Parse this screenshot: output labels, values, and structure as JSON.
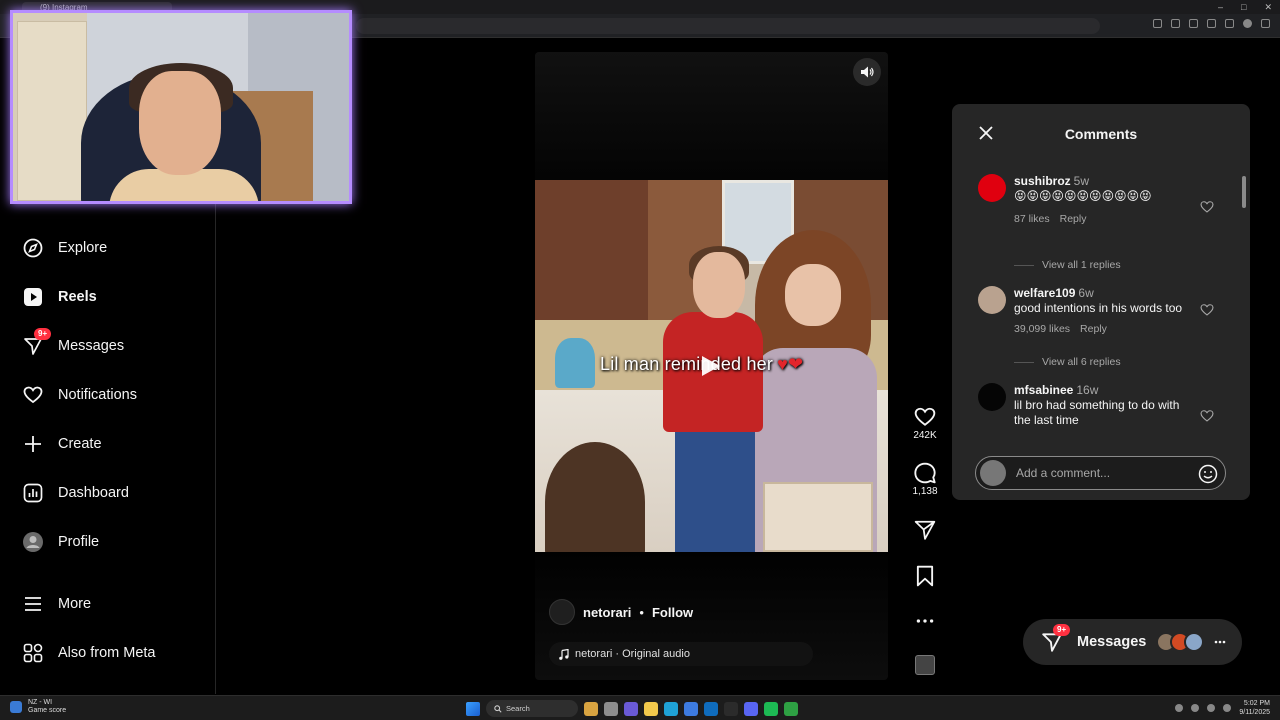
{
  "browser": {
    "tab_title": "(9) Instagram",
    "window_controls": [
      "–",
      "□",
      "✕"
    ]
  },
  "sidebar": {
    "items": [
      {
        "label": "Explore",
        "icon": "compass-icon"
      },
      {
        "label": "Reels",
        "icon": "reels-icon"
      },
      {
        "label": "Messages",
        "icon": "messenger-icon",
        "badge": "9+"
      },
      {
        "label": "Notifications",
        "icon": "heart-icon"
      },
      {
        "label": "Create",
        "icon": "plus-icon"
      },
      {
        "label": "Dashboard",
        "icon": "dashboard-icon"
      },
      {
        "label": "Profile",
        "icon": "profile-avatar"
      },
      {
        "label": "More",
        "icon": "menu-icon"
      },
      {
        "label": "Also from Meta",
        "icon": "meta-icon"
      }
    ]
  },
  "reel": {
    "caption": "Lil man reminded her",
    "caption_emoji": "♥❤",
    "author": "netorari",
    "separator": "•",
    "follow_label": "Follow",
    "audio": "netorari · Original audio",
    "likes": "242K",
    "comments": "1,138"
  },
  "comments_panel": {
    "title": "Comments",
    "add_placeholder": "Add a comment...",
    "items": [
      {
        "user": "sushibroz",
        "time": "5w",
        "text": "😝😝😝😝😝😝😝😝😝😝😝",
        "likes": "87 likes",
        "reply": "Reply",
        "view_replies": "View all 1 replies",
        "avatar_color": "#e0000f"
      },
      {
        "user": "welfare109",
        "time": "6w",
        "text": "good intentions in his words too",
        "likes": "39,099 likes",
        "reply": "Reply",
        "view_replies": "View all 6 replies",
        "avatar_color": "#b9a28f"
      },
      {
        "user": "mfsabinee",
        "time": "16w",
        "text": "lil bro had something to do with the last time",
        "avatar_color": "#050505"
      }
    ]
  },
  "messages_pill": {
    "label": "Messages",
    "badge": "9+"
  },
  "taskbar": {
    "weather_title": "NZ - WI",
    "weather_sub": "Game score",
    "search": "Search",
    "time": "5:02 PM",
    "date": "9/11/2025"
  },
  "colors": {
    "accent": "#0095f6",
    "badge": "#ff3040",
    "panel": "#262626",
    "webcam_border": "#b58cff"
  }
}
